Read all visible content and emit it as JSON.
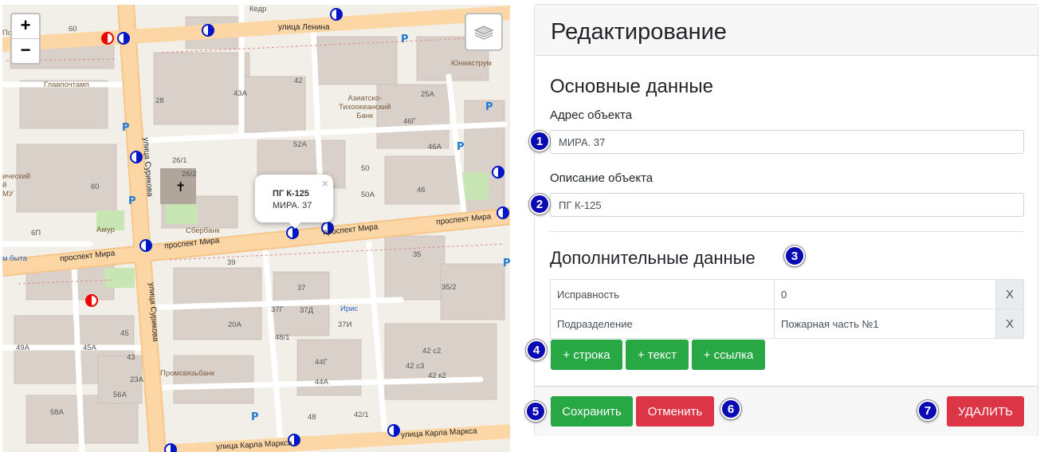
{
  "map": {
    "zoom_in": "+",
    "zoom_out": "−",
    "popup": {
      "title": "ПГ К-125",
      "address": "МИРА. 37",
      "close": "×"
    },
    "streets": {
      "lenina": "улица Ленина",
      "mira_left": "проспект Мира",
      "mira_mid": "проспект Мира",
      "mira_right": "проспект Мира",
      "mira_far_left": "проспект Мира",
      "surikova_top": "улица Сурикова",
      "surikova_bottom": "улица Сурикова",
      "karla_marksa_left": "улица Карла Маркса",
      "karla_marksa_right": "улица Карла Маркса"
    },
    "places": {
      "kedr": "Кедр",
      "glavpochtamp": "Главпочтамп",
      "bank": "Азиатско-\nТихоокеанский\nБанк",
      "unistrum": "Юниаструм",
      "sberbank": "Сбербанк",
      "amur": "Амур",
      "iris": "Ирис",
      "promsvyazbank": "Промсвязьбанк",
      "mu_byta": "м быта",
      "left_edge1": "ический",
      "left_edge2": "й",
      "left_edge3": "МУ",
      "pochta": "Почте"
    },
    "house_numbers": [
      "60",
      "28",
      "43А",
      "42",
      "25А",
      "52А",
      "46Г",
      "46А",
      "26/1",
      "26/2",
      "50",
      "50А",
      "46",
      "60",
      "6П",
      "39",
      "35",
      "37",
      "37Г",
      "37Д",
      "35/2",
      "37И",
      "20А",
      "48/1",
      "45А",
      "45",
      "49А",
      "43",
      "23А",
      "42 с3",
      "42 к2",
      "56А",
      "44Г",
      "44А",
      "42 с2",
      "42/1",
      "58А",
      "48"
    ]
  },
  "panel": {
    "header_title": "Редактирование",
    "main_section_title": "Основные данные",
    "address_label": "Адрес объекта",
    "address_value": "МИРА. 37",
    "description_label": "Описание объекта",
    "description_value": "ПГ К-125",
    "extra_section_title": "Дополнительные данные",
    "rows": [
      {
        "key": "Исправность",
        "value": "0",
        "remove": "X"
      },
      {
        "key": "Подразделение",
        "value": "Пожарная часть №1",
        "remove": "X"
      }
    ],
    "add_row_button": "+ строка",
    "add_text_button": "+ текст",
    "add_link_button": "+ ссылка",
    "save_button": "Сохранить",
    "cancel_button": "Отменить",
    "delete_button": "УДАЛИТЬ"
  },
  "badges": [
    "1",
    "2",
    "3",
    "4",
    "5",
    "6",
    "7"
  ],
  "colors": {
    "green": "#28a745",
    "red": "#dc3545",
    "badge": "#0a0ab5",
    "road_primary": "#fcd6a4",
    "building": "#d9d0c9"
  }
}
